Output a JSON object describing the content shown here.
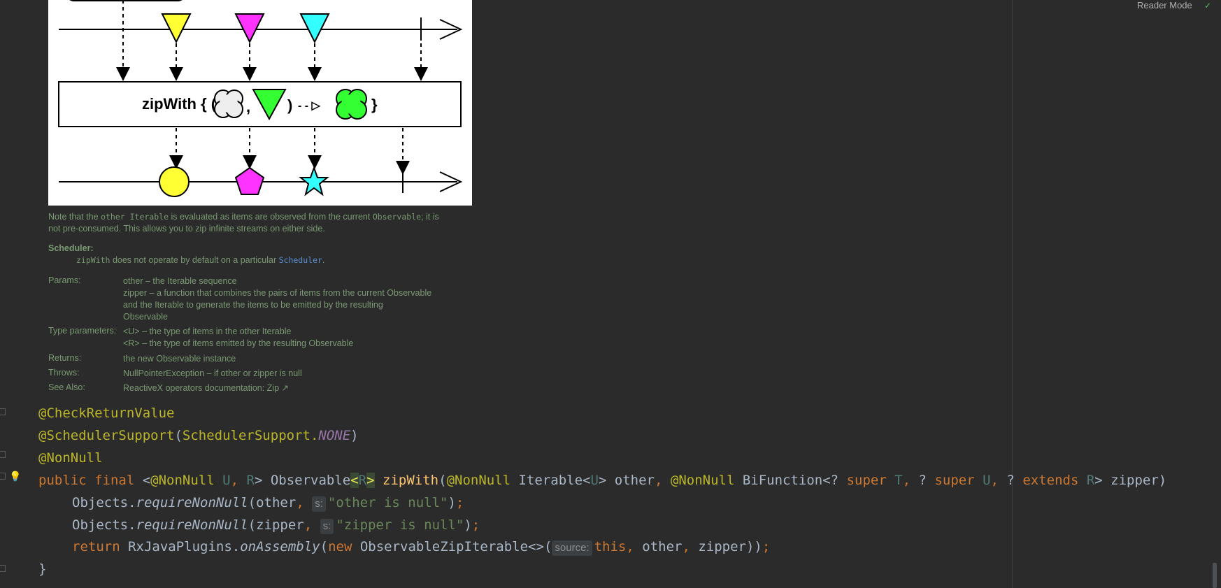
{
  "header": {
    "reader_mode": "Reader Mode",
    "check_icon": "checkmark-icon"
  },
  "diagram": {
    "operator_label": "zipWith { (",
    "comma": ",",
    "closing": ")",
    "arrow": "- - ▷",
    "brace": "}",
    "colors": {
      "yellow": "#ffff33",
      "magenta": "#ff33ff",
      "cyan": "#33ffff",
      "green": "#33ff33"
    }
  },
  "doc": {
    "note_line1_a": "Note that the ",
    "note_line1_code1": "other Iterable",
    "note_line1_b": " is evaluated as items are observed from the current ",
    "note_line1_code2": "Observable",
    "note_line1_c": "; it is",
    "note_line2": "not pre-consumed. This allows you to zip infinite streams on either side.",
    "scheduler_heading": "Scheduler:",
    "scheduler_code": "zipWith",
    "scheduler_text": " does not operate by default on a particular ",
    "scheduler_link": "Scheduler",
    "scheduler_end": ".",
    "params_label": "Params:",
    "params_line1_a": "other – the ",
    "params_line1_code": "Iterable",
    "params_line1_b": " sequence",
    "params_line2_a": "zipper – a function that combines the pairs of items from the current ",
    "params_line2_code": "Observable",
    "params_line3_a": "and the ",
    "params_line3_code": "Iterable",
    "params_line3_b": " to generate the items to be emitted by the resulting",
    "params_line4_code": "Observable",
    "type_params_label": "Type parameters:",
    "type_line1_a": "<U> – the type of items in the ",
    "type_line1_code": "other Iterable",
    "type_line2_a": "<R> – the type of items emitted by the resulting ",
    "type_line2_code": "Observable",
    "returns_label": "Returns:",
    "returns_a": "the new ",
    "returns_code": "Observable",
    "returns_b": " instance",
    "throws_label": "Throws:",
    "throws_link": "NullPointerException",
    "throws_a": " – if ",
    "throws_code1": "other",
    "throws_b": " or ",
    "throws_code2": "zipper",
    "throws_c": " is ",
    "throws_code3": "null",
    "see_also_label": "See Also:",
    "see_also_link": "ReactiveX operators documentation: Zip ↗"
  },
  "code": {
    "line1": "@CheckReturnValue",
    "line2_ann": "@SchedulerSupport",
    "line2_open": "(",
    "line2_cls": "SchedulerSupport.",
    "line2_const": "NONE",
    "line2_close": ")",
    "line3": "@NonNull",
    "line4": {
      "kw1": "public final ",
      "lt": "<",
      "ann1": "@NonNull",
      "sp1": " ",
      "u": "U",
      "comma1": ", ",
      "r": "R",
      "gt": "> Observable",
      "lt2": "<",
      "r2": "R",
      "gt2": ">",
      "sp2": " ",
      "fn": "zipWith",
      "open": "(",
      "ann2": "@NonNull",
      "iter": " Iterable<",
      "u2": "U",
      "other": "> other",
      "comma2": ", ",
      "ann3": "@NonNull",
      "bif": " BiFunction<? ",
      "super1": "super ",
      "t": "T",
      "comma3": ", ",
      "q2": "? ",
      "super2": "super ",
      "u3": "U",
      "comma4": ", ",
      "q3": "? ",
      "extends": "extends ",
      "r3": "R",
      "zipper": "> zipper)"
    },
    "line5": {
      "obj": "Objects.",
      "call": "requireNonNull",
      "args": "(other",
      "comma": ", ",
      "hint": "s:",
      "str": "\"other is null\"",
      "end": ")",
      "semi": ";"
    },
    "line6": {
      "obj": "Objects.",
      "call": "requireNonNull",
      "args": "(zipper",
      "comma": ", ",
      "hint": "s:",
      "str": "\"zipper is null\"",
      "end": ")",
      "semi": ";"
    },
    "line7": {
      "ret": "return ",
      "cls": "RxJavaPlugins.",
      "call": "onAssembly",
      "open": "(",
      "new": "new ",
      "cls2": "ObservableZipIterable<>(",
      "hint": "source:",
      "this": "this",
      "comma1": ", ",
      "other": "other",
      "comma2": ", ",
      "zipper": "zipper))",
      "semi": ";"
    },
    "line8": "}"
  }
}
